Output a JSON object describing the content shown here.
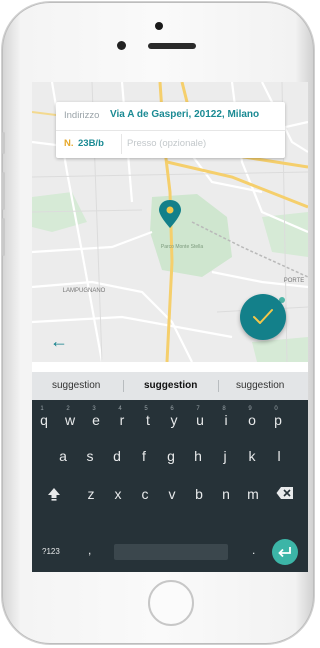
{
  "address": {
    "label": "Indirizzo",
    "value": "Via A de Gasperi, 20122, Milano",
    "number_label": "N.",
    "number_value": "23B/b",
    "extra_placeholder": "Presso (opzionale)"
  },
  "map": {
    "labels": [
      "Parco Monte Stella",
      "LAMPUGNANO",
      "PORTE"
    ]
  },
  "nav": {
    "back_icon": "arrow-left-icon"
  },
  "confirm": {
    "icon": "check-icon",
    "color": "#13808a"
  },
  "suggestions": [
    "suggestion",
    "suggestion",
    "suggestion"
  ],
  "keyboard": {
    "row1": [
      "q",
      "w",
      "e",
      "r",
      "t",
      "y",
      "u",
      "i",
      "o",
      "p"
    ],
    "row1_hints": [
      "1",
      "2",
      "3",
      "4",
      "5",
      "6",
      "7",
      "8",
      "9",
      "0"
    ],
    "row2": [
      "a",
      "s",
      "d",
      "f",
      "g",
      "h",
      "j",
      "k",
      "l"
    ],
    "row3": [
      "z",
      "x",
      "c",
      "v",
      "b",
      "n",
      "m"
    ],
    "symbols_label": "?123",
    "comma": ",",
    "period": ".",
    "colors": {
      "background": "#263238",
      "enter": "#3cb5a7"
    }
  }
}
